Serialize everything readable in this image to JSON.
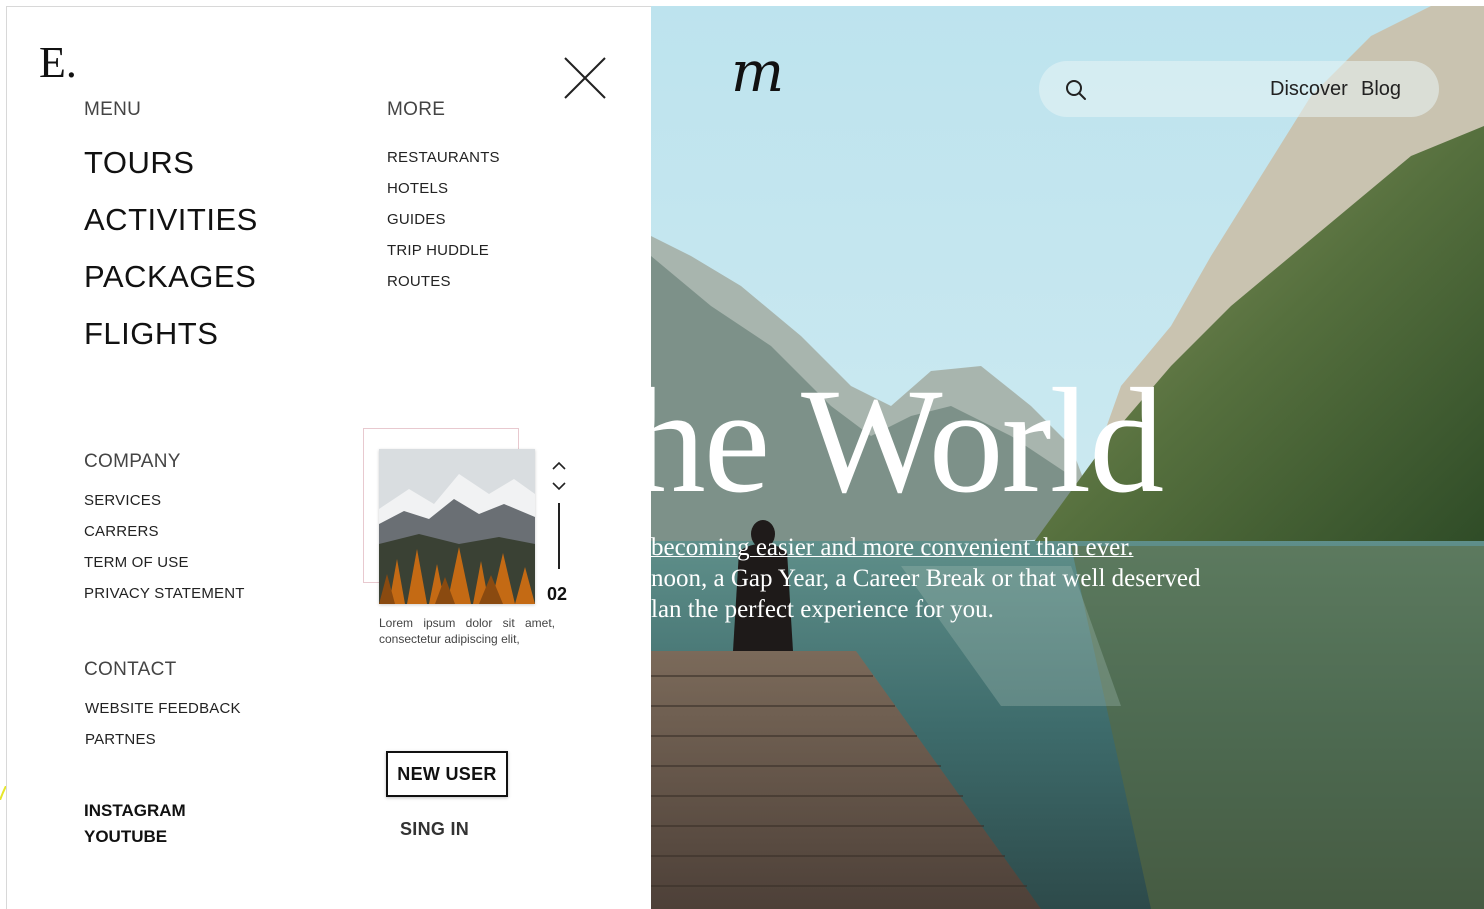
{
  "brand": {
    "logo": "E."
  },
  "hero": {
    "logo": "m",
    "nav": {
      "discover": "Discover",
      "blog": "Blog"
    },
    "headline": "the World",
    "subtext": [
      "becoming easier and more convenient than ever.",
      "noon, a Gap Year, a Career Break or that well deserved",
      "lan the perfect experience for you."
    ]
  },
  "menu": {
    "title": "MENU",
    "items": [
      "TOURS",
      "ACTIVITIES",
      "PACKAGES",
      "FLIGHTS"
    ]
  },
  "more": {
    "title": "MORE",
    "items": [
      "RESTAURANTS",
      "HOTELS",
      "GUIDES",
      "TRIP HUDDLE",
      "ROUTES"
    ]
  },
  "company": {
    "title": "COMPANY",
    "items": [
      "SERVICES",
      "CARRERS",
      "TERM OF USE",
      "PRIVACY STATEMENT"
    ]
  },
  "contact": {
    "title": "CONTACT",
    "items": [
      "WEBSITE FEEDBACK",
      "PARTNES"
    ]
  },
  "social": {
    "items": [
      "INSTAGRAM",
      "YOUTUBE"
    ]
  },
  "gallery": {
    "counter": "02",
    "caption": "Lorem ipsum dolor sit amet, consectetur adipiscing elit,"
  },
  "auth": {
    "new_user": "NEW USER",
    "sign_in": "SING IN"
  },
  "icons": {
    "close": "close-icon",
    "search": "search-icon",
    "up": "chevron-up-icon",
    "down": "chevron-down-icon"
  },
  "colors": {
    "accent_yellow": "#e6e62a",
    "text": "#111111"
  }
}
